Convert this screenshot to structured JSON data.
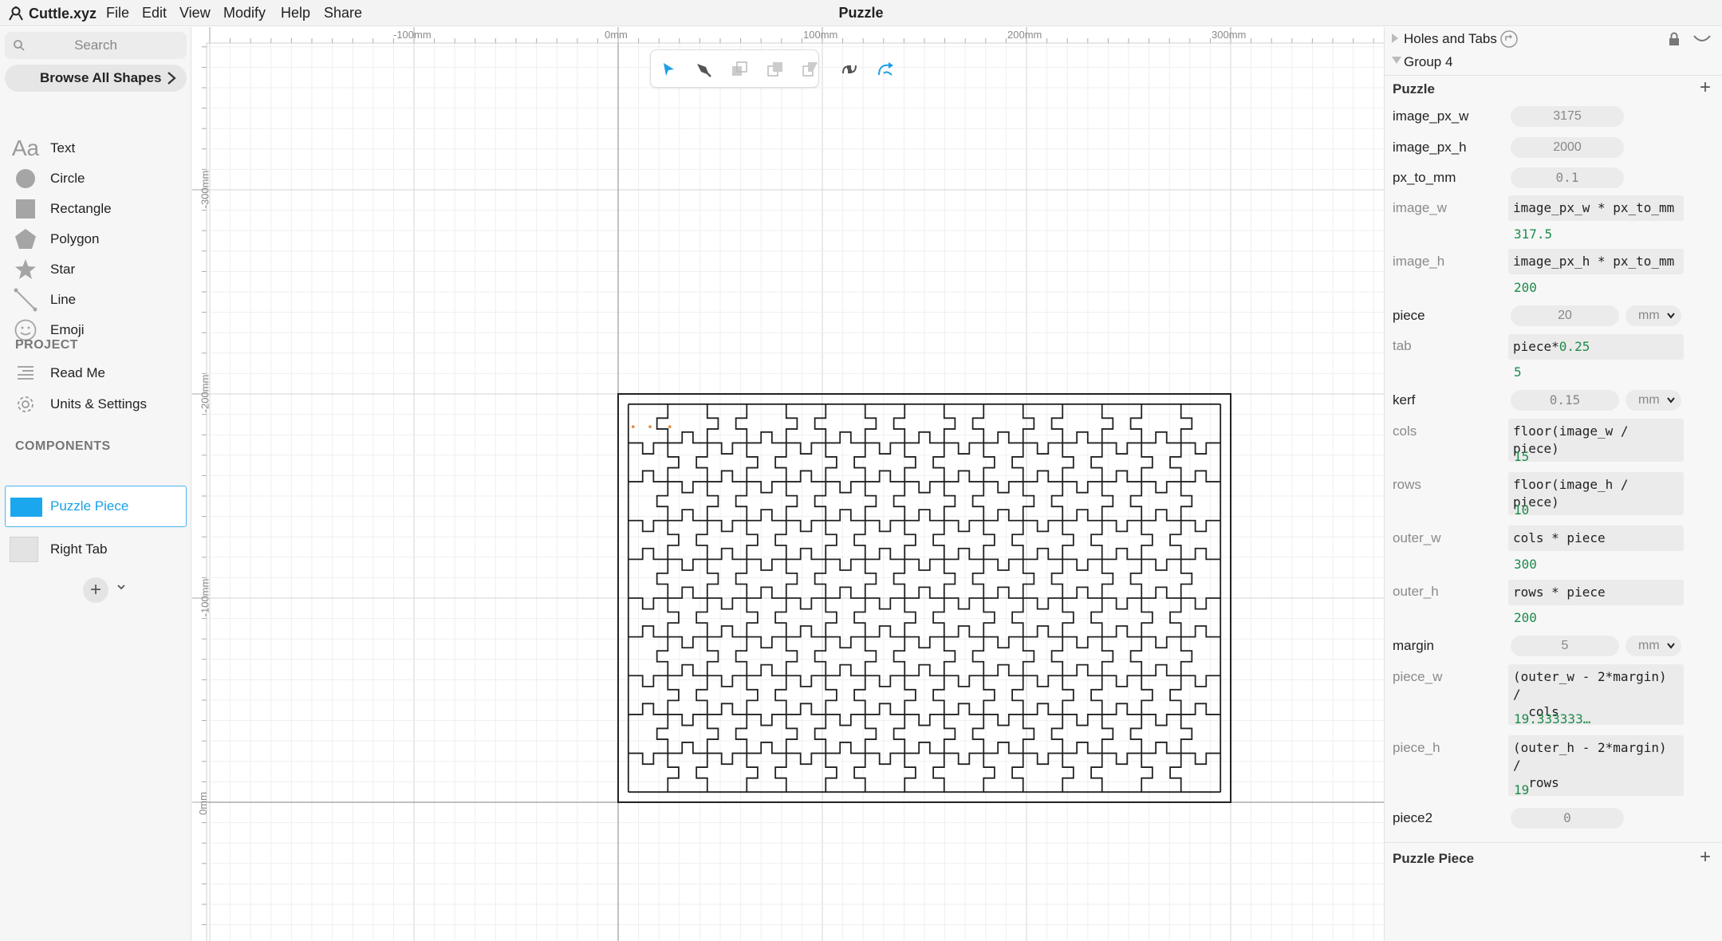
{
  "app": {
    "name": "Cuttle.xyz",
    "menu": [
      "File",
      "Edit",
      "View",
      "Modify",
      "Help",
      "Share"
    ],
    "document_title": "Puzzle"
  },
  "sidebar": {
    "search_placeholder": "Search",
    "browse_label": "Browse All Shapes",
    "shapes": [
      {
        "label": "Text",
        "icon": "text-aa-icon"
      },
      {
        "label": "Circle",
        "icon": "circle-icon"
      },
      {
        "label": "Rectangle",
        "icon": "rectangle-icon"
      },
      {
        "label": "Polygon",
        "icon": "polygon-icon"
      },
      {
        "label": "Star",
        "icon": "star-icon"
      },
      {
        "label": "Line",
        "icon": "line-icon"
      },
      {
        "label": "Emoji",
        "icon": "emoji-icon"
      }
    ],
    "project_heading": "PROJECT",
    "project_items": [
      {
        "label": "Read Me",
        "icon": "read-me-icon"
      },
      {
        "label": "Units & Settings",
        "icon": "gear-icon"
      }
    ],
    "components_heading": "COMPONENTS",
    "components": [
      {
        "label": "Puzzle Piece",
        "selected": true
      },
      {
        "label": "Right Tab",
        "selected": false
      }
    ]
  },
  "canvas": {
    "ruler_x": [
      "-100mm",
      "0mm",
      "100mm",
      "200mm",
      "300mm"
    ],
    "ruler_y": [
      "-300mm",
      "-200mm",
      "-100mm",
      "0mm"
    ],
    "tools": [
      "pointer-tool-icon",
      "pen-tool-icon",
      "boolean-union-icon",
      "boolean-subtract-icon",
      "boolean-intersect-icon",
      "join-paths-icon",
      "rotate-tool-icon"
    ],
    "puzzle": {
      "cols": 15,
      "rows": 10,
      "stroke_color": "#222222",
      "marker_color": "#e08a3a"
    }
  },
  "panel": {
    "tree": [
      {
        "label": "Holes and Tabs",
        "expanded": false
      },
      {
        "label": "Group 4",
        "expanded": true
      }
    ],
    "puzzle_heading": "Puzzle",
    "params": {
      "image_px_w": {
        "name": "image_px_w",
        "value": "3175"
      },
      "image_px_h": {
        "name": "image_px_h",
        "value": "2000"
      },
      "px_to_mm": {
        "name": "px_to_mm",
        "value": "0.1"
      },
      "image_w": {
        "name": "image_w",
        "expr": "image_px_w * px_to_mm",
        "result": "317.5"
      },
      "image_h": {
        "name": "image_h",
        "expr": "image_px_h * px_to_mm",
        "result": "200"
      },
      "piece": {
        "name": "piece",
        "value": "20",
        "unit": "mm"
      },
      "tab": {
        "name": "tab",
        "expr_plain": "piece*",
        "expr_num": "0.25",
        "result": "5"
      },
      "kerf": {
        "name": "kerf",
        "value": "0.15",
        "unit": "mm"
      },
      "cols": {
        "name": "cols",
        "expr": "floor(image_w / piece)",
        "result": "15"
      },
      "rows": {
        "name": "rows",
        "expr": "floor(image_h / piece)",
        "result": "10"
      },
      "outer_w": {
        "name": "outer_w",
        "expr": "cols * piece",
        "result": "300"
      },
      "outer_h": {
        "name": "outer_h",
        "expr": "rows * piece",
        "result": "200"
      },
      "margin": {
        "name": "margin",
        "value": "5",
        "unit": "mm"
      },
      "piece_w": {
        "name": "piece_w",
        "expr": "(outer_w - 2*margin) /\n  cols",
        "result": "19.333333…"
      },
      "piece_h": {
        "name": "piece_h",
        "expr": "(outer_h - 2*margin) /\n  rows",
        "result": "19"
      },
      "piece2": {
        "name": "piece2",
        "value": "0"
      }
    },
    "puzzle_piece_heading": "Puzzle Piece"
  }
}
